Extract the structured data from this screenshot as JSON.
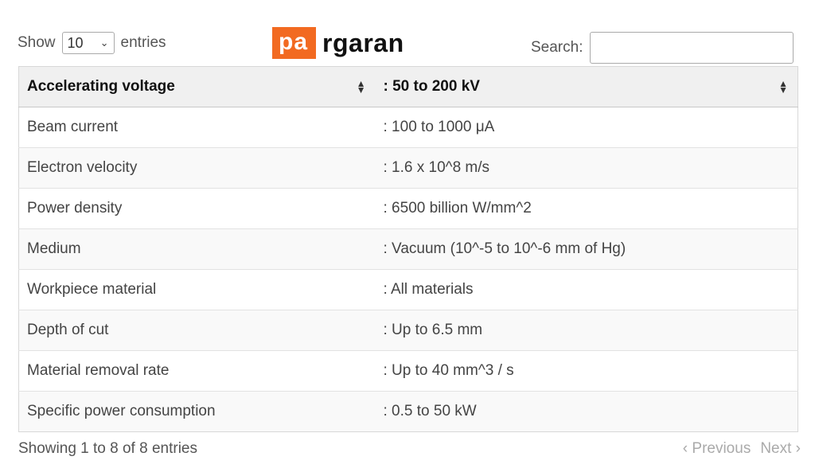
{
  "length_control": {
    "show_label": "Show",
    "selected": "10",
    "entries_label": "entries"
  },
  "logo": {
    "part1": "pa",
    "part2": "rgaran",
    "brand_color": "#f26a21"
  },
  "search": {
    "label": "Search:",
    "value": "",
    "placeholder": ""
  },
  "table": {
    "header": [
      "Accelerating voltage",
      ": 50 to 200 kV"
    ],
    "rows": [
      [
        "Beam current",
        ": 100 to 1000 μA"
      ],
      [
        "Electron velocity",
        ": 1.6 x 10^8 m/s"
      ],
      [
        "Power density",
        ": 6500 billion W/mm^2"
      ],
      [
        "Medium",
        ": Vacuum (10^-5 to 10^-6 mm of Hg)"
      ],
      [
        "Workpiece material",
        ": All materials"
      ],
      [
        "Depth of cut",
        ": Up to 6.5 mm"
      ],
      [
        "Material removal rate",
        ": Up to 40 mm^3 / s"
      ],
      [
        "Specific power consumption",
        ": 0.5 to 50 kW"
      ]
    ]
  },
  "info": "Showing 1 to 8 of 8 entries",
  "pagination": {
    "previous": "Previous",
    "next": "Next",
    "prev_icon": "chevron-left-icon",
    "next_icon": "chevron-right-icon"
  }
}
